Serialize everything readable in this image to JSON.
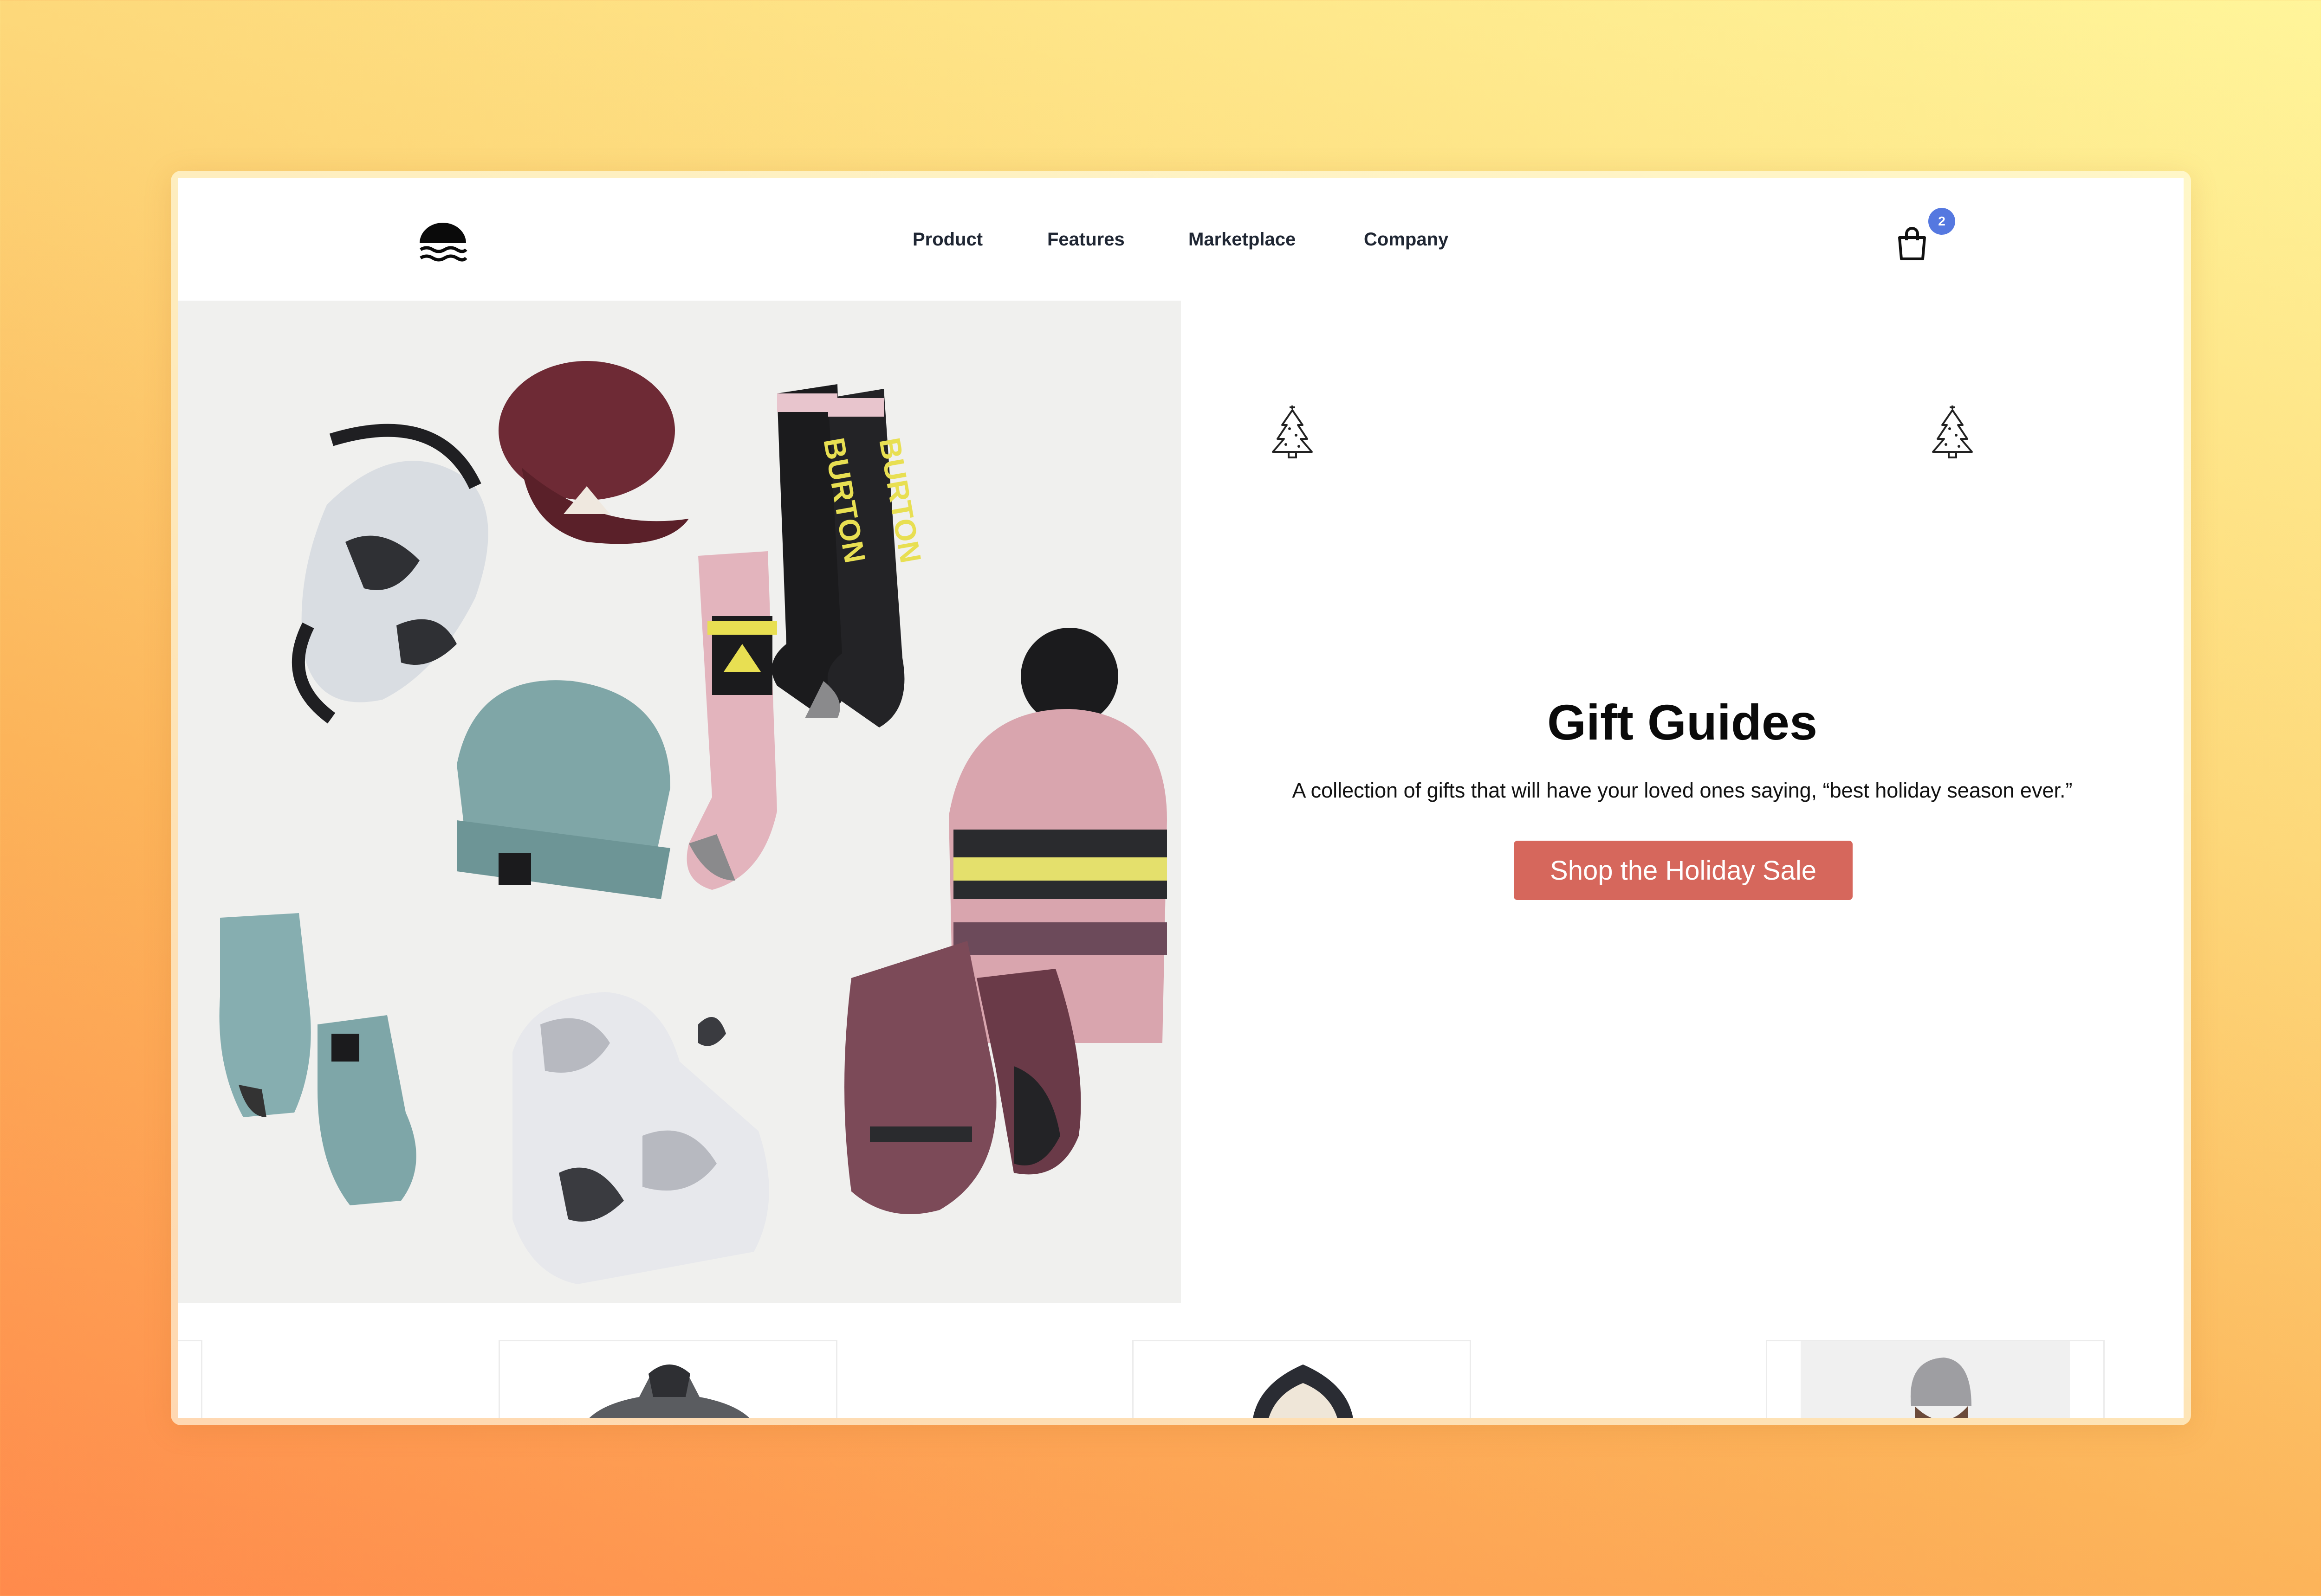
{
  "header": {
    "logo_icon": "waves-sun-logo",
    "nav": [
      {
        "label": "Product"
      },
      {
        "label": "Features"
      },
      {
        "label": "Marketplace"
      },
      {
        "label": "Company"
      }
    ],
    "cart": {
      "icon": "shopping-bag-icon",
      "badge_count": "2"
    }
  },
  "hero": {
    "image_subject": "winter-gear-flatlay",
    "decoration_icon": "christmas-tree-icon",
    "title": "Gift Guides",
    "subtitle": "A collection of gifts that will have your loved ones saying, “best holiday season ever.”",
    "cta_label": "Shop the Holiday Sale"
  },
  "products": [
    {
      "image": "partial-card"
    },
    {
      "image": "fleece-jacket"
    },
    {
      "image": "sherpa-hood-jacket"
    },
    {
      "image": "person-grey-beanie"
    }
  ],
  "colors": {
    "cta": "#d6675c",
    "badge": "#5578e0",
    "nav_text": "#1f2633",
    "hero_bg": "#f0f0ee"
  }
}
